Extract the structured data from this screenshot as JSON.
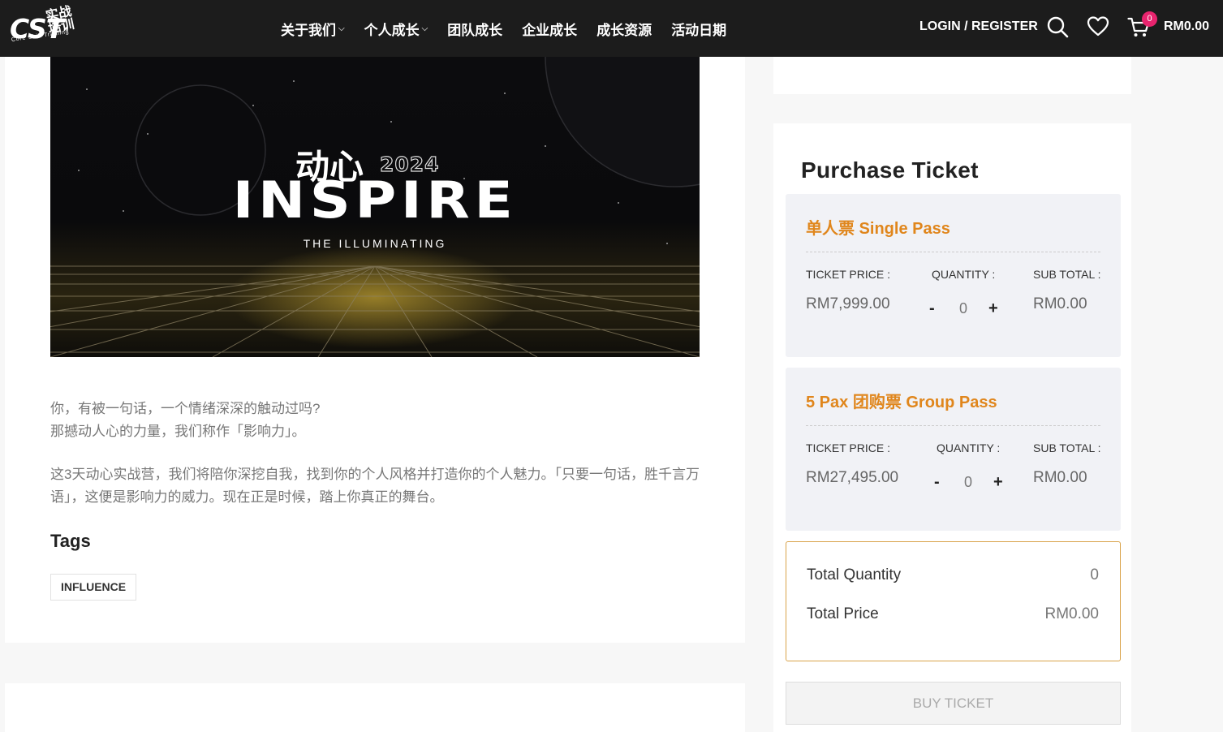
{
  "header": {
    "logo": {
      "main": "CST",
      "cn": "实战培训",
      "sub": "Core Skill Training"
    },
    "nav": [
      {
        "label": "关于我们",
        "has_caret": true
      },
      {
        "label": "个人成长",
        "has_caret": true
      },
      {
        "label": "团队成长",
        "has_caret": false
      },
      {
        "label": "企业成长",
        "has_caret": false
      },
      {
        "label": "成长资源",
        "has_caret": false
      },
      {
        "label": "活动日期",
        "has_caret": false
      }
    ],
    "login_label": "LOGIN / REGISTER",
    "icons": [
      "search-icon",
      "heart-icon",
      "cart-icon"
    ],
    "cart_count": "0",
    "cart_total": "RM0.00",
    "badge_color": "#e8246e"
  },
  "article": {
    "banner": {
      "cn_title": "动心",
      "year": "2024",
      "title": "INSPIRE",
      "subtitle": "THE ILLUMINATING"
    },
    "paragraph_1_line_1": "你，有被一句话，一个情绪深深的触动过吗?",
    "paragraph_1_line_2": "那撼动人心的力量，我们称作「影响力」。",
    "paragraph_2": "这3天动心实战营，我们将陪你深挖自我，找到你的个人风格并打造你的个人魅力。「只要一句话，胜千言万语」，这便是影响力的威力。现在正是时候，踏上你真正的舞台。",
    "tags_title": "Tags",
    "tags": [
      "INFLUENCE"
    ]
  },
  "purchase": {
    "title": "Purchase Ticket",
    "accent_color": "#e0861c",
    "passes": [
      {
        "name": "单人票 Single Pass",
        "price_label": "TICKET PRICE :",
        "qty_label": "QUANTITY :",
        "sub_label": "SUB TOTAL :",
        "price": "RM7,999.00",
        "minus": "-",
        "quantity": "0",
        "plus": "+",
        "subtotal": "RM0.00"
      },
      {
        "name": "5 Pax 团购票 Group Pass",
        "price_label": "TICKET PRICE :",
        "qty_label": "QUANTITY :",
        "sub_label": "SUB TOTAL :",
        "price": "RM27,495.00",
        "minus": "-",
        "quantity": "0",
        "plus": "+",
        "subtotal": "RM0.00"
      }
    ],
    "total_quantity_label": "Total Quantity",
    "total_quantity": "0",
    "total_price_label": "Total Price",
    "total_price": "RM0.00",
    "buy_label": "BUY TICKET"
  }
}
